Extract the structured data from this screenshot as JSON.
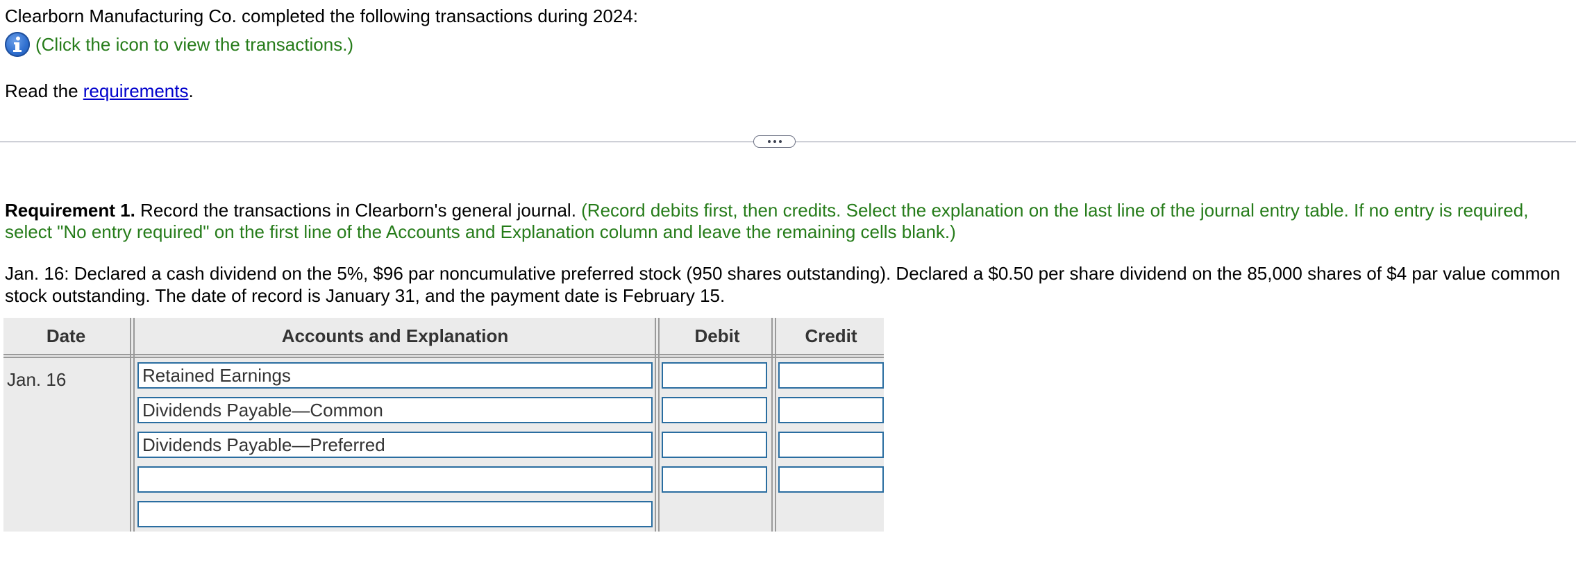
{
  "intro_text": "Clearborn Manufacturing Co. completed the following transactions during 2024:",
  "info_link_text": "(Click the icon to view the transactions.)",
  "read_prefix": "Read the ",
  "requirements_link": "requirements",
  "read_suffix": ".",
  "requirement": {
    "label": "Requirement 1.",
    "text": " Record the transactions in Clearborn's general journal. ",
    "instructions": "(Record debits first, then credits. Select the explanation on the last line of the journal entry table. If no entry is required, select \"No entry required\" on the first line of the Accounts and Explanation column and leave the remaining cells blank.)"
  },
  "transaction_text": "Jan. 16: Declared a cash dividend on the 5%, $96 par noncumulative preferred stock (950 shares outstanding). Declared a $0.50 per share dividend on the 85,000 shares of $4 par value common stock outstanding. The date of record is January 31, and the payment date is February 15.",
  "journal": {
    "headers": {
      "date": "Date",
      "accounts": "Accounts and Explanation",
      "debit": "Debit",
      "credit": "Credit"
    },
    "date": "Jan. 16",
    "rows": [
      {
        "account": "Retained Earnings",
        "debit": "",
        "credit": ""
      },
      {
        "account": "Dividends Payable—Common",
        "debit": "",
        "credit": ""
      },
      {
        "account": "Dividends Payable—Preferred",
        "debit": "",
        "credit": ""
      },
      {
        "account": "",
        "debit": "",
        "credit": ""
      },
      {
        "account": ""
      }
    ]
  },
  "colors": {
    "green": "#267c1a",
    "link": "#0000cc",
    "input_border": "#2a6da0",
    "table_bg": "#ebebeb"
  },
  "icons": {
    "info": "info-icon",
    "expander": "more-dots-icon"
  }
}
